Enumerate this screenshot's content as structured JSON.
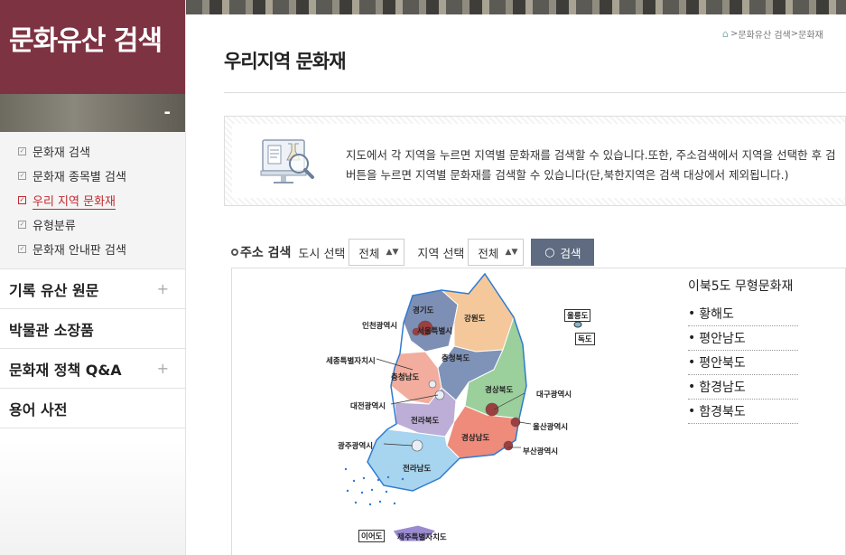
{
  "sidebar": {
    "title": "문화유산 검색",
    "sub_items": [
      {
        "label": "문화재 검색",
        "active": false
      },
      {
        "label": "문화재 종목별 검색",
        "active": false
      },
      {
        "label": "우리 지역 문화재",
        "active": true
      },
      {
        "label": "유형분류",
        "active": false
      },
      {
        "label": "문화재 안내판 검색",
        "active": false
      }
    ],
    "menus": [
      {
        "label": "기록 유산 원문",
        "expandable": true
      },
      {
        "label": "박물관 소장품",
        "expandable": false
      },
      {
        "label": "문화재 정책 Q&A",
        "expandable": true
      },
      {
        "label": "용어 사전",
        "expandable": false
      }
    ]
  },
  "breadcrumb": {
    "items": [
      "문화유산 검색",
      "문화재"
    ]
  },
  "page": {
    "title": "우리지역 문화재"
  },
  "info": {
    "line1": "지도에서 각 지역을 누르면 지역별 문화재를 검색할 수 있습니다.또한, 주소검색에서 지역을 선택한 후 검",
    "line2": "버튼을 누르면 지역별 문화재를 검색할 수 있습니다(단,북한지역은 검색 대상에서 제외됩니다.)"
  },
  "search": {
    "label": "주소 검색",
    "city_label": "도시 선택",
    "city_value": "전체",
    "region_label": "지역 선택",
    "region_value": "전체",
    "button": "검색"
  },
  "map": {
    "labels": {
      "gyeonggi": "경기도",
      "incheon": "인천광역시",
      "seoul": "서울특별시",
      "gangwon": "강원도",
      "ulleung": "울릉도",
      "dokdo": "독도",
      "sejong": "세종특별자치시",
      "chungbuk": "충청북도",
      "chungnam": "충청남도",
      "gyeongbuk": "경상북도",
      "daegu": "대구광역시",
      "daejeon": "대전광역시",
      "jeonbuk": "전라북도",
      "ulsan": "울산광역시",
      "gyeongnam": "경상남도",
      "gwangju": "광주광역시",
      "busan": "부산광역시",
      "jeonnam": "전라남도",
      "ieodo": "이어도",
      "jeju": "제주특별자치도"
    },
    "colors": {
      "gyeonggi": "#7d8fb5",
      "gangwon": "#f4c89a",
      "chungbuk": "#7f93b8",
      "chungnam": "#f2ad9e",
      "gyeongbuk": "#9bcf9c",
      "jeonbuk": "#bcaed6",
      "gyeongnam": "#ef8b7a",
      "jeonnam": "#a7d4ee",
      "jeju": "#9a8ad0",
      "metro": "#9b3f3f",
      "outline": "#2e7ad1"
    }
  },
  "north": {
    "title": "이북5도 무형문화재",
    "items": [
      "황해도",
      "평안남도",
      "평안북도",
      "함경남도",
      "함경북도"
    ]
  }
}
